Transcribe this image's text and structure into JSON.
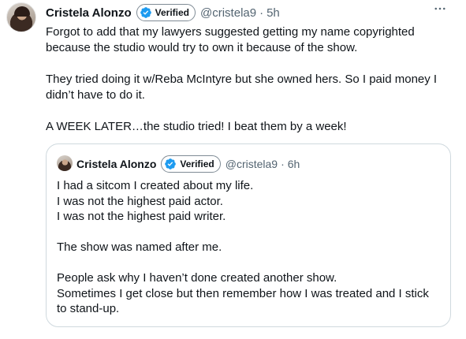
{
  "tweet": {
    "author_name": "Cristela Alonzo",
    "verified_label": "Verified",
    "handle": "@cristela9",
    "separator": "·",
    "time": "5h",
    "paragraphs": [
      [
        "Forgot to add that my lawyers suggested getting my name copyrighted",
        "because the studio would try to own it because of the show."
      ],
      [
        "They tried doing it w/Reba McIntyre but she owned hers. So I paid money I",
        "didn’t have to do it."
      ],
      [
        "A WEEK LATER…the studio tried! I beat them by a week!"
      ]
    ]
  },
  "quoted": {
    "author_name": "Cristela Alonzo",
    "verified_label": "Verified",
    "handle": "@cristela9",
    "separator": "·",
    "time": "6h",
    "paragraphs": [
      [
        "I had a sitcom I created about my life.",
        "I was not the highest paid actor.",
        "I was not the highest paid writer."
      ],
      [
        "The show was named after me."
      ],
      [
        "People ask why I haven’t done created another show.",
        "Sometimes I get close but then remember how I was treated and I stick",
        "to stand-up."
      ]
    ]
  },
  "colors": {
    "verified_blue": "#1d9bf0",
    "secondary_text": "#536471",
    "border": "#cfd9de"
  },
  "icons": {
    "verified": "verified-check-icon",
    "more": "more-options-icon"
  }
}
